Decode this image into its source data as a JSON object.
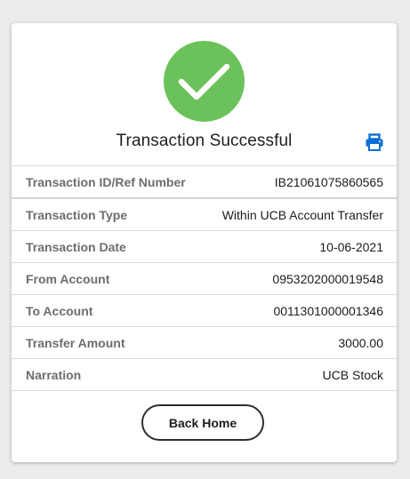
{
  "status": {
    "title": "Transaction Successful",
    "icon": "checkmark-icon",
    "color": "#6cc25a"
  },
  "print_icon": "printer-icon",
  "accent_color": "#0b6fd6",
  "details": [
    {
      "label": "Transaction ID/Ref Number",
      "value": "IB21061075860565"
    },
    {
      "label": "Transaction Type",
      "value": "Within UCB Account Transfer"
    },
    {
      "label": "Transaction Date",
      "value": "10-06-2021"
    },
    {
      "label": "From Account",
      "value": "0953202000019548"
    },
    {
      "label": "To Account",
      "value": "0011301000001346"
    },
    {
      "label": "Transfer Amount",
      "value": "3000.00"
    },
    {
      "label": "Narration",
      "value": "UCB Stock"
    }
  ],
  "back_button": {
    "label": "Back Home"
  }
}
